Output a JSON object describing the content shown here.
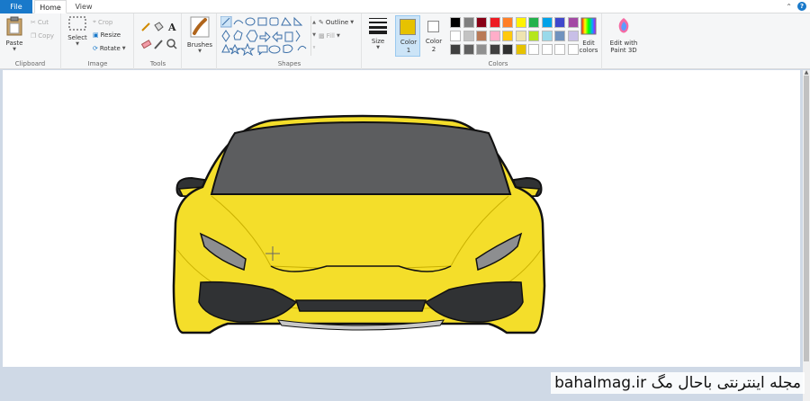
{
  "tabs": {
    "file": "File",
    "home": "Home",
    "view": "View"
  },
  "clipboard": {
    "paste": "Paste",
    "cut": "Cut",
    "copy": "Copy",
    "label": "Clipboard"
  },
  "image": {
    "select": "Select",
    "crop": "Crop",
    "resize": "Resize",
    "rotate": "Rotate",
    "label": "Image"
  },
  "tools": {
    "label": "Tools"
  },
  "brushes": {
    "label": "Brushes"
  },
  "shapes": {
    "outline": "Outline",
    "fill": "Fill",
    "label": "Shapes"
  },
  "size": {
    "label": "Size"
  },
  "color1": {
    "label": "Color 1",
    "color": "#e6c200"
  },
  "color2": {
    "label": "Color 2",
    "color": "#ffffff"
  },
  "colors": {
    "label": "Colors",
    "row1": [
      "#000000",
      "#7f7f7f",
      "#880015",
      "#ed1c24",
      "#ff7f27",
      "#fff200",
      "#22b14c",
      "#00a2e8",
      "#3f48cc",
      "#a349a4"
    ],
    "row2": [
      "#ffffff",
      "#c3c3c3",
      "#b97a57",
      "#ffaec9",
      "#ffc90e",
      "#efe4b0",
      "#b5e61d",
      "#99d9ea",
      "#7092be",
      "#c8bfe7"
    ],
    "row3": [
      "#404040",
      "#606060",
      "#909090",
      "#404040",
      "#303030",
      "#e6c200",
      "#ffffff",
      "#ffffff",
      "#ffffff",
      "#ffffff"
    ],
    "edit": "Edit colors",
    "paint3d": "Edit with Paint 3D"
  },
  "watermark": "bahalmag.ir مجله اینترنتی باحال مگ",
  "accent": "#1979ca",
  "car_color": "#f4de2a"
}
